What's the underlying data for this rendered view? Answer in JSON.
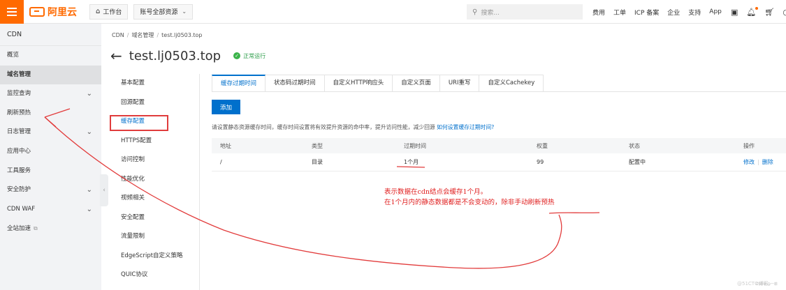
{
  "topbar": {
    "brand": "阿里云",
    "workbench_label": "工作台",
    "account_label": "账号全部资源",
    "search_placeholder": "搜索...",
    "nav": [
      "费用",
      "工单",
      "ICP 备案",
      "企业",
      "支持",
      "App"
    ]
  },
  "sidebar": {
    "title": "CDN",
    "items": [
      {
        "label": "概览"
      },
      {
        "label": "域名管理",
        "active": true
      },
      {
        "label": "监控查询",
        "expandable": true
      },
      {
        "label": "刷新预热"
      },
      {
        "label": "日志管理",
        "expandable": true
      },
      {
        "label": "应用中心"
      },
      {
        "label": "工具服务"
      },
      {
        "label": "安全防护",
        "expandable": true
      },
      {
        "label": "CDN WAF",
        "expandable": true
      },
      {
        "label": "全站加速",
        "external": true
      }
    ]
  },
  "breadcrumb": [
    "CDN",
    "域名管理",
    "test.lj0503.top"
  ],
  "page": {
    "domain": "test.lj0503.top",
    "status": "正常运行"
  },
  "config_nav": {
    "items": [
      "基本配置",
      "回源配置",
      "缓存配置",
      "HTTPS配置",
      "访问控制",
      "性能优化",
      "视频相关",
      "安全配置",
      "流量限制",
      "EdgeScript自定义策略",
      "QUIC协议"
    ],
    "active": "缓存配置"
  },
  "tabs": [
    "缓存过期时间",
    "状态码过期时间",
    "自定义HTTP响应头",
    "自定义页面",
    "URI重写",
    "自定义Cachekey"
  ],
  "add_button": "添加",
  "description": {
    "text": "请设置静态资源缓存时间，缓存时间设置将有效提升资源的命中率，提升访问性能，减少回源",
    "link": "如何设置缓存过期时间?"
  },
  "table": {
    "columns": [
      "地址",
      "类型",
      "过期时间",
      "权重",
      "状态",
      "操作"
    ],
    "rows": [
      {
        "address": "/",
        "type": "目录",
        "expire": "1个月",
        "weight": "99",
        "status": "配置中",
        "action_edit": "修改",
        "action_delete": "删除"
      }
    ]
  },
  "annotation": {
    "line1": "表示数据在cdn结点会缓存1个月。",
    "line2": "在1个月内的静态数据都是不会变动的，除非手动刷新预热"
  },
  "watermark": {
    "a": "CSDN @一菲",
    "b": "@51CTO博客"
  },
  "colors": {
    "brand": "#ff6a00",
    "accent": "#0070cc",
    "annotation": "#e02020",
    "status_ok": "#3bb34a"
  }
}
